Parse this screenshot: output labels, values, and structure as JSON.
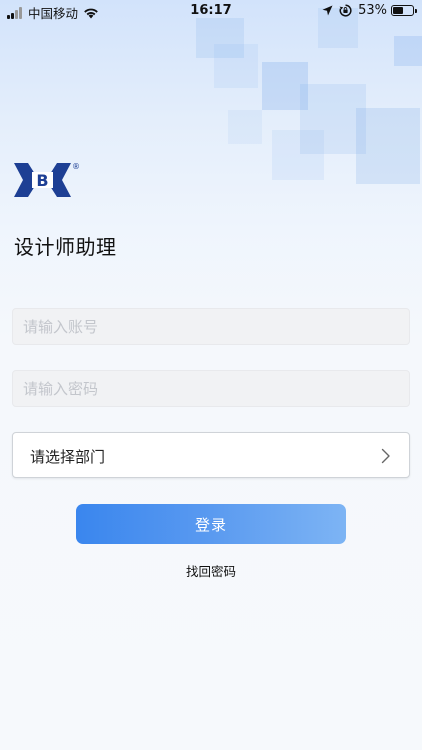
{
  "status_bar": {
    "carrier": "中国移动",
    "time": "16:17",
    "battery_percent_label": "53%",
    "battery_level": 0.53
  },
  "app": {
    "title": "设计师助理",
    "logo_letter": "B",
    "logo_mark": "®"
  },
  "form": {
    "account_placeholder": "请输入账号",
    "account_value": "",
    "password_placeholder": "请输入密码",
    "password_value": "",
    "department_label": "请选择部门",
    "login_label": "登录",
    "forgot_label": "找回密码"
  },
  "colors": {
    "accent": "#3a86ee",
    "accent_light": "#7db4f4",
    "logo_blue": "#1d3f94"
  }
}
